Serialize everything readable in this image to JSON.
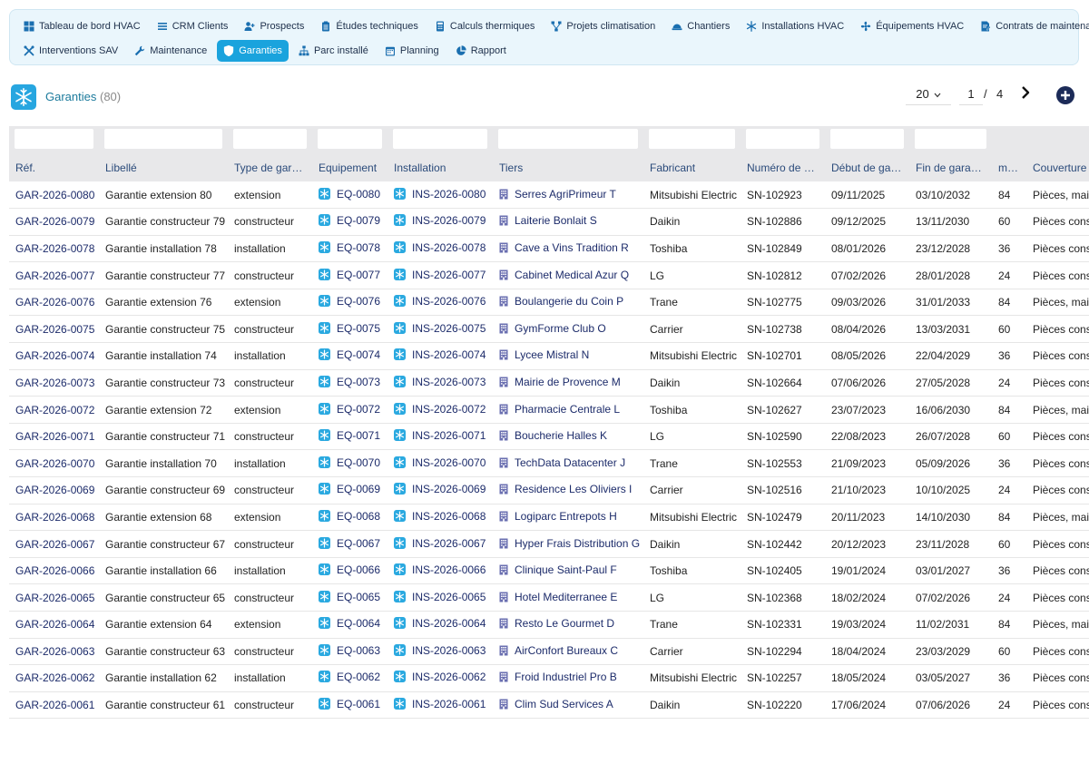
{
  "nav": {
    "row1": [
      {
        "label": "Tableau de bord HVAC",
        "icon": "dashboard-icon"
      },
      {
        "label": "CRM Clients",
        "icon": "list-icon"
      },
      {
        "label": "Prospects",
        "icon": "user-plus-icon"
      },
      {
        "label": "Études techniques",
        "icon": "clipboard-icon"
      },
      {
        "label": "Calculs thermiques",
        "icon": "calculator-icon"
      },
      {
        "label": "Projets climatisation",
        "icon": "project-icon"
      },
      {
        "label": "Chantiers",
        "icon": "helmet-icon"
      },
      {
        "label": "Installations HVAC",
        "icon": "snowflake-icon"
      },
      {
        "label": "Équipements HVAC",
        "icon": "fan-icon"
      },
      {
        "label": "Contrats de maintenance",
        "icon": "contract-icon"
      }
    ],
    "row2": [
      {
        "label": "Interventions SAV",
        "icon": "tools-icon"
      },
      {
        "label": "Maintenance",
        "icon": "wrench-icon"
      },
      {
        "label": "Garanties",
        "icon": "shield-icon",
        "active": true
      },
      {
        "label": "Parc installé",
        "icon": "sitemap-icon"
      },
      {
        "label": "Planning",
        "icon": "calendar-icon"
      },
      {
        "label": "Rapport",
        "icon": "pie-chart-icon"
      }
    ]
  },
  "header": {
    "title": "Garanties",
    "count": "(80)"
  },
  "pager": {
    "page_size": "20",
    "page": "1",
    "separator": "/",
    "total_pages": "4"
  },
  "table": {
    "columns": [
      "Réf.",
      "Libellé",
      "Type de garantie",
      "Equipement",
      "Installation",
      "Tiers",
      "Fabricant",
      "Numéro de série",
      "Début de garantie",
      "Fin de garantie",
      "mois",
      "Couverture"
    ],
    "rows": [
      [
        "GAR-2026-0080",
        "Garantie extension 80",
        "extension",
        "EQ-0080",
        "INS-2026-0080",
        "Serres AgriPrimeur T",
        "Mitsubishi Electric",
        "SN-102923",
        "09/11/2025",
        "03/10/2032",
        "84",
        "Pièces, main d'oeuvre"
      ],
      [
        "GAR-2026-0079",
        "Garantie constructeur 79",
        "constructeur",
        "EQ-0079",
        "INS-2026-0079",
        "Laiterie Bonlait S",
        "Daikin",
        "SN-102886",
        "09/12/2025",
        "13/11/2030",
        "60",
        "Pièces constructeur"
      ],
      [
        "GAR-2026-0078",
        "Garantie installation 78",
        "installation",
        "EQ-0078",
        "INS-2026-0078",
        "Cave a Vins Tradition R",
        "Toshiba",
        "SN-102849",
        "08/01/2026",
        "23/12/2028",
        "36",
        "Pièces constructeur"
      ],
      [
        "GAR-2026-0077",
        "Garantie constructeur 77",
        "constructeur",
        "EQ-0077",
        "INS-2026-0077",
        "Cabinet Medical Azur Q",
        "LG",
        "SN-102812",
        "07/02/2026",
        "28/01/2028",
        "24",
        "Pièces constructeur"
      ],
      [
        "GAR-2026-0076",
        "Garantie extension 76",
        "extension",
        "EQ-0076",
        "INS-2026-0076",
        "Boulangerie du Coin P",
        "Trane",
        "SN-102775",
        "09/03/2026",
        "31/01/2033",
        "84",
        "Pièces, main d'oeuvre"
      ],
      [
        "GAR-2026-0075",
        "Garantie constructeur 75",
        "constructeur",
        "EQ-0075",
        "INS-2026-0075",
        "GymForme Club O",
        "Carrier",
        "SN-102738",
        "08/04/2026",
        "13/03/2031",
        "60",
        "Pièces constructeur"
      ],
      [
        "GAR-2026-0074",
        "Garantie installation 74",
        "installation",
        "EQ-0074",
        "INS-2026-0074",
        "Lycee Mistral N",
        "Mitsubishi Electric",
        "SN-102701",
        "08/05/2026",
        "22/04/2029",
        "36",
        "Pièces constructeur"
      ],
      [
        "GAR-2026-0073",
        "Garantie constructeur 73",
        "constructeur",
        "EQ-0073",
        "INS-2026-0073",
        "Mairie de Provence M",
        "Daikin",
        "SN-102664",
        "07/06/2026",
        "27/05/2028",
        "24",
        "Pièces constructeur"
      ],
      [
        "GAR-2026-0072",
        "Garantie extension 72",
        "extension",
        "EQ-0072",
        "INS-2026-0072",
        "Pharmacie Centrale L",
        "Toshiba",
        "SN-102627",
        "23/07/2023",
        "16/06/2030",
        "84",
        "Pièces, main d'oeuvre"
      ],
      [
        "GAR-2026-0071",
        "Garantie constructeur 71",
        "constructeur",
        "EQ-0071",
        "INS-2026-0071",
        "Boucherie Halles K",
        "LG",
        "SN-102590",
        "22/08/2023",
        "26/07/2028",
        "60",
        "Pièces constructeur"
      ],
      [
        "GAR-2026-0070",
        "Garantie installation 70",
        "installation",
        "EQ-0070",
        "INS-2026-0070",
        "TechData Datacenter J",
        "Trane",
        "SN-102553",
        "21/09/2023",
        "05/09/2026",
        "36",
        "Pièces constructeur"
      ],
      [
        "GAR-2026-0069",
        "Garantie constructeur 69",
        "constructeur",
        "EQ-0069",
        "INS-2026-0069",
        "Residence Les Oliviers I",
        "Carrier",
        "SN-102516",
        "21/10/2023",
        "10/10/2025",
        "24",
        "Pièces constructeur"
      ],
      [
        "GAR-2026-0068",
        "Garantie extension 68",
        "extension",
        "EQ-0068",
        "INS-2026-0068",
        "Logiparc Entrepots H",
        "Mitsubishi Electric",
        "SN-102479",
        "20/11/2023",
        "14/10/2030",
        "84",
        "Pièces, main d'oeuvre"
      ],
      [
        "GAR-2026-0067",
        "Garantie constructeur 67",
        "constructeur",
        "EQ-0067",
        "INS-2026-0067",
        "Hyper Frais Distribution G",
        "Daikin",
        "SN-102442",
        "20/12/2023",
        "23/11/2028",
        "60",
        "Pièces constructeur"
      ],
      [
        "GAR-2026-0066",
        "Garantie installation 66",
        "installation",
        "EQ-0066",
        "INS-2026-0066",
        "Clinique Saint-Paul F",
        "Toshiba",
        "SN-102405",
        "19/01/2024",
        "03/01/2027",
        "36",
        "Pièces constructeur"
      ],
      [
        "GAR-2026-0065",
        "Garantie constructeur 65",
        "constructeur",
        "EQ-0065",
        "INS-2026-0065",
        "Hotel Mediterranee E",
        "LG",
        "SN-102368",
        "18/02/2024",
        "07/02/2026",
        "24",
        "Pièces constructeur"
      ],
      [
        "GAR-2026-0064",
        "Garantie extension 64",
        "extension",
        "EQ-0064",
        "INS-2026-0064",
        "Resto Le Gourmet D",
        "Trane",
        "SN-102331",
        "19/03/2024",
        "11/02/2031",
        "84",
        "Pièces, main d'oeuvre"
      ],
      [
        "GAR-2026-0063",
        "Garantie constructeur 63",
        "constructeur",
        "EQ-0063",
        "INS-2026-0063",
        "AirConfort Bureaux C",
        "Carrier",
        "SN-102294",
        "18/04/2024",
        "23/03/2029",
        "60",
        "Pièces constructeur"
      ],
      [
        "GAR-2026-0062",
        "Garantie installation 62",
        "installation",
        "EQ-0062",
        "INS-2026-0062",
        "Froid Industriel Pro B",
        "Mitsubishi Electric",
        "SN-102257",
        "18/05/2024",
        "03/05/2027",
        "36",
        "Pièces constructeur"
      ],
      [
        "GAR-2026-0061",
        "Garantie constructeur 61",
        "constructeur",
        "EQ-0061",
        "INS-2026-0061",
        "Clim Sud Services A",
        "Daikin",
        "SN-102220",
        "17/06/2024",
        "07/06/2026",
        "24",
        "Pièces constructeur"
      ]
    ]
  },
  "colors": {
    "accent": "#1aa3dd",
    "link": "#1c2b6a",
    "header_bg": "#e8e8ea",
    "nav_bg": "#eaf6fc"
  }
}
